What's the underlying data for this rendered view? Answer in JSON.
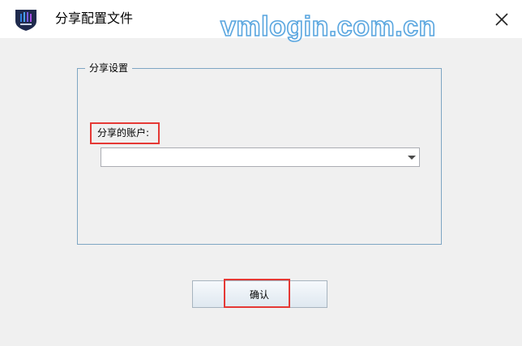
{
  "window": {
    "title": "分享配置文件",
    "close_icon": "close-icon",
    "logo_icon": "app-logo-icon"
  },
  "watermark": "vmlogin.com.cn",
  "share_settings": {
    "legend": "分享设置",
    "account_label": "分享的账户:",
    "account_value": ""
  },
  "buttons": {
    "confirm": "确认"
  },
  "colors": {
    "highlight": "#e53935",
    "group_border": "#7ea6c3",
    "watermark_stroke": "#5aa6df"
  }
}
